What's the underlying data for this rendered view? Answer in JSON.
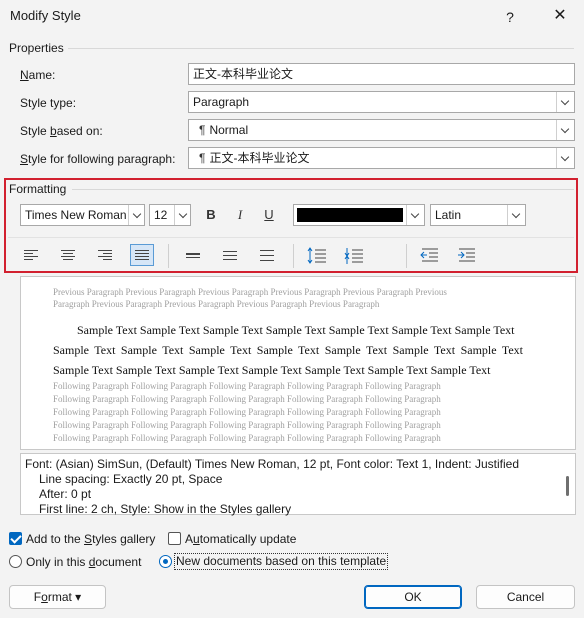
{
  "window": {
    "title": "Modify Style",
    "help_glyph": "?",
    "close_glyph": "✕"
  },
  "properties": {
    "heading": "Properties",
    "name": {
      "label_u": "N",
      "label_rest": "ame:",
      "value": "正文-本科毕业论文"
    },
    "style_type": {
      "label": "Style type:",
      "value": "Paragraph"
    },
    "style_based_on": {
      "label_pre": "Style ",
      "label_u": "b",
      "label_rest": "ased on:",
      "value": "Normal"
    },
    "following": {
      "label_u": "S",
      "label_rest": "tyle for following paragraph:",
      "value": "正文-本科毕业论文"
    },
    "pilcrow": "¶"
  },
  "formatting": {
    "heading": "Formatting",
    "font": "Times New Roman",
    "size": "12",
    "bold": "B",
    "italic": "I",
    "underline": "U",
    "font_color": "#000000",
    "script": "Latin"
  },
  "preview": {
    "previous": "Previous Paragraph Previous Paragraph Previous Paragraph Previous Paragraph Previous Paragraph Previous Paragraph Previous Paragraph Previous Paragraph Previous Paragraph Previous Paragraph",
    "sample_line1": "Sample Text Sample Text Sample Text Sample Text Sample Text Sample Text Sample Text",
    "sample_line2": "Sample Text Sample Text Sample Text Sample Text Sample Text Sample Text Sample Text",
    "sample_line3": "Sample Text Sample Text Sample Text Sample Text Sample Text Sample Text Sample Text",
    "following_line": "Following Paragraph Following Paragraph Following Paragraph Following Paragraph Following Paragraph"
  },
  "description": {
    "line1": "Font: (Asian) SimSun, (Default) Times New Roman, 12 pt, Font color: Text 1, Indent: Justified",
    "line2": "Line spacing:  Exactly 20 pt, Space",
    "line3": "After:  0 pt",
    "line4": "First line:  2 ch, Style: Show in the Styles gallery"
  },
  "options": {
    "add_to_gallery": {
      "label_pre": "Add to the ",
      "label_u": "S",
      "label_rest": "tyles gallery",
      "checked": true
    },
    "auto_update": {
      "label_pre": "A",
      "label_u": "u",
      "label_rest": "tomatically update",
      "checked": false
    },
    "only_this_doc": {
      "label_pre": "Only in this ",
      "label_u": "d",
      "label_rest": "ocument",
      "selected": false
    },
    "new_docs": {
      "label": "New documents based on this template",
      "selected": true
    }
  },
  "buttons": {
    "format_pre": "F",
    "format_u": "o",
    "format_rest": "rmat",
    "format_arrow": "▾",
    "ok": "OK",
    "cancel": "Cancel"
  },
  "colors": {
    "accent": "#0067c0",
    "highlight_box": "#d2202f"
  }
}
